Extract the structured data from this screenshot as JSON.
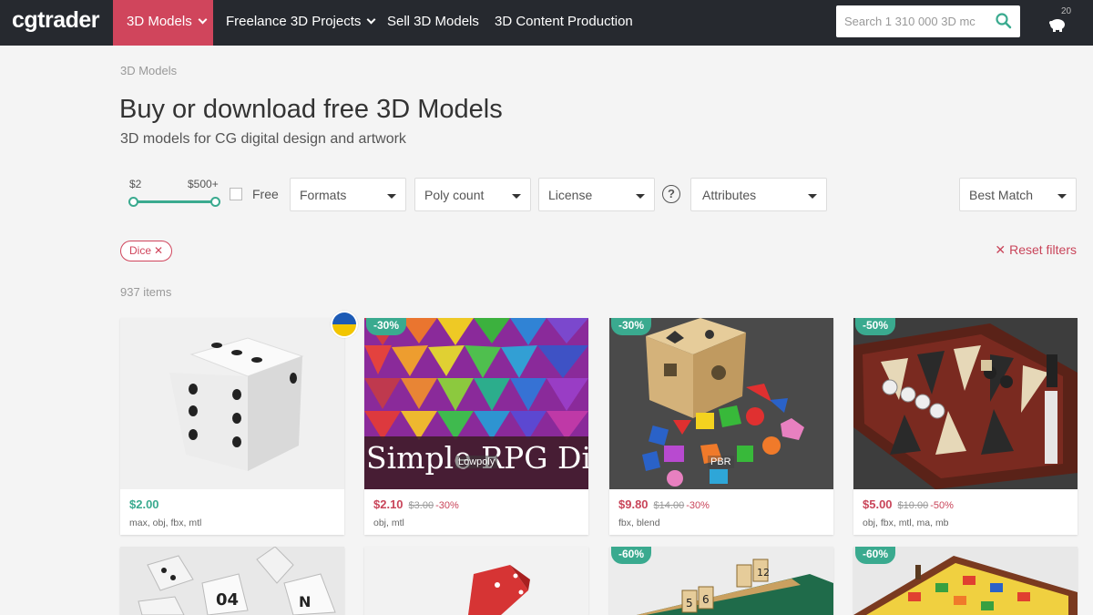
{
  "nav": {
    "logo": "cgtrader",
    "items": [
      {
        "label": "3D Models"
      },
      {
        "label": "Freelance 3D Projects"
      },
      {
        "label": "Sell 3D Models"
      },
      {
        "label": "3D Content Production"
      }
    ],
    "search_placeholder": "Search 1 310 000 3D mc",
    "cart_count": "20"
  },
  "header": {
    "breadcrumb": "3D Models",
    "title": "Buy or download free 3D Models",
    "subtitle": "3D models for CG digital design and artwork"
  },
  "filters": {
    "price_min": "$2",
    "price_max": "$500+",
    "free_label": "Free",
    "formats": "Formats",
    "poly_count": "Poly count",
    "license": "License",
    "help": "?",
    "attributes": "Attributes",
    "sort": "Best Match",
    "active_tag": "Dice",
    "reset_label": "Reset filters",
    "item_count": "937 items"
  },
  "colors": {
    "accent": "#d0455c",
    "teal": "#3aaa8f",
    "nav_bg": "#26292f"
  },
  "products": [
    {
      "price": "$2.00",
      "old_price": "",
      "discount": "",
      "badge": "",
      "formats": "max, obj, fbx, mtl",
      "label": "",
      "icon": "dice-thumbnail"
    },
    {
      "price": "$2.10",
      "old_price": "$3.00",
      "discount": "-30%",
      "badge": "-30%",
      "formats": "obj, mtl",
      "label": "Lowpoly",
      "overlay_text": "Simple RPG Dice",
      "icon": "rpg-dice-thumbnail"
    },
    {
      "price": "$9.80",
      "old_price": "$14.00",
      "discount": "-30%",
      "badge": "-30%",
      "formats": "fbx, blend",
      "label": "PBR",
      "icon": "shape-sorter-thumbnail"
    },
    {
      "price": "$5.00",
      "old_price": "$10.00",
      "discount": "-50%",
      "badge": "-50%",
      "formats": "obj, fbx, mtl, ma, mb",
      "label": "",
      "icon": "backgammon-thumbnail"
    },
    {
      "badge": "",
      "icon": "numbered-dice-thumbnail"
    },
    {
      "badge": "",
      "icon": "red-die-thumbnail"
    },
    {
      "badge": "-60%",
      "icon": "shut-the-box-thumbnail"
    },
    {
      "badge": "-60%",
      "icon": "board-game-thumbnail"
    }
  ]
}
